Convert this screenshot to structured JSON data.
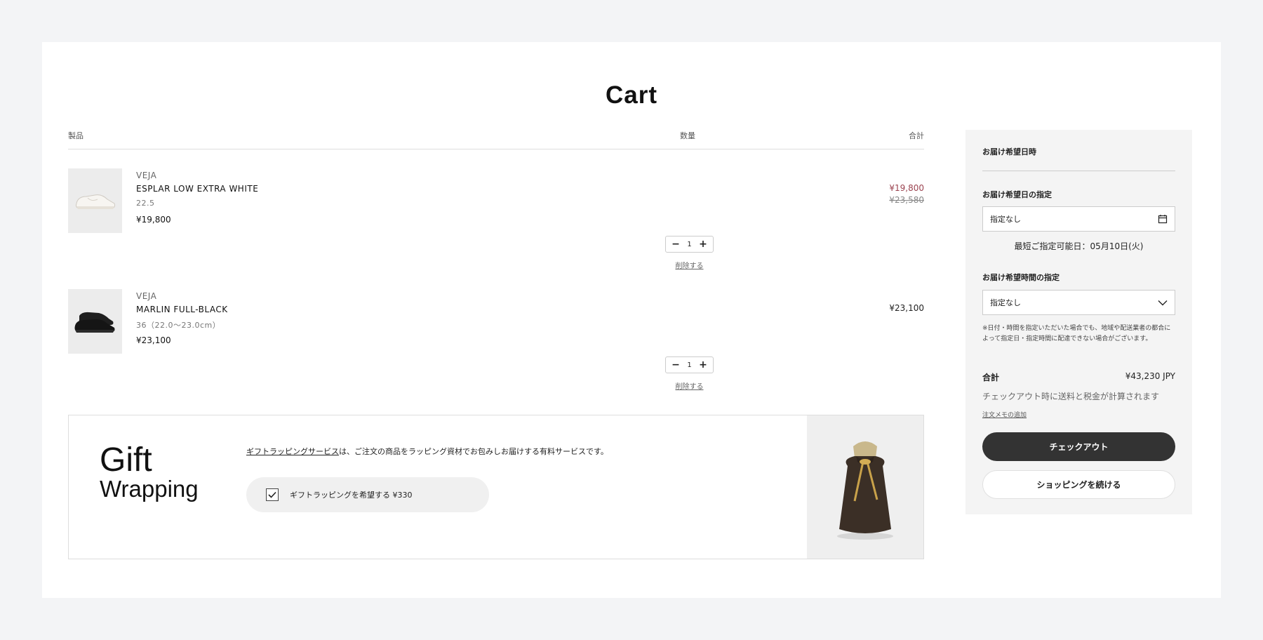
{
  "page": {
    "title": "Cart"
  },
  "table": {
    "col_product": "製品",
    "col_qty": "数量",
    "col_total": "合計"
  },
  "items": [
    {
      "brand": "VEJA",
      "name": "ESPLAR LOW EXTRA WHITE",
      "variant": "22.5",
      "unit_price": "¥19,800",
      "line_total": "¥19,800",
      "original_total": "¥23,580",
      "quantity": "1",
      "remove_label": "削除する",
      "image_icon": "white-sneaker-icon"
    },
    {
      "brand": "VEJA",
      "name": "MARLIN FULL-BLACK",
      "variant": "36（22.0〜23.0cm）",
      "unit_price": "¥23,100",
      "line_total": "¥23,100",
      "quantity": "1",
      "remove_label": "削除する",
      "image_icon": "black-sneaker-icon"
    }
  ],
  "gift": {
    "title_line1": "Gift",
    "title_line2": "Wrapping",
    "link_text": "ギフトラッピングサービス",
    "desc_rest": "は、ご注文の商品をラッピング資材でお包みしお届けする有料サービスです。",
    "checkbox_label": "ギフトラッピングを希望する ¥330",
    "checked": true,
    "image_icon": "gift-bag-icon"
  },
  "sidebar": {
    "heading": "お届け希望日時",
    "date_label": "お届け希望日の指定",
    "date_value": "指定なし",
    "earliest": "最短ご指定可能日：05月10日(火)",
    "time_label": "お届け希望時間の指定",
    "time_value": "指定なし",
    "note": "※日付・時間を指定いただいた場合でも、地域や配送業者の都合によって指定日・指定時間に配達できない場合がございます。",
    "total_label": "合計",
    "total_value": "¥43,230 JPY",
    "tax_note": "チェックアウト時に送料と税金が計算されます",
    "memo_link": "注文メモの追加",
    "checkout_label": "チェックアウト",
    "continue_label": "ショッピングを続ける"
  },
  "colors": {
    "sale_price": "#9b4350",
    "checkout_button": "#333333",
    "sidebar_bg": "#f4f4f4",
    "page_bg": "#f3f4f6"
  }
}
